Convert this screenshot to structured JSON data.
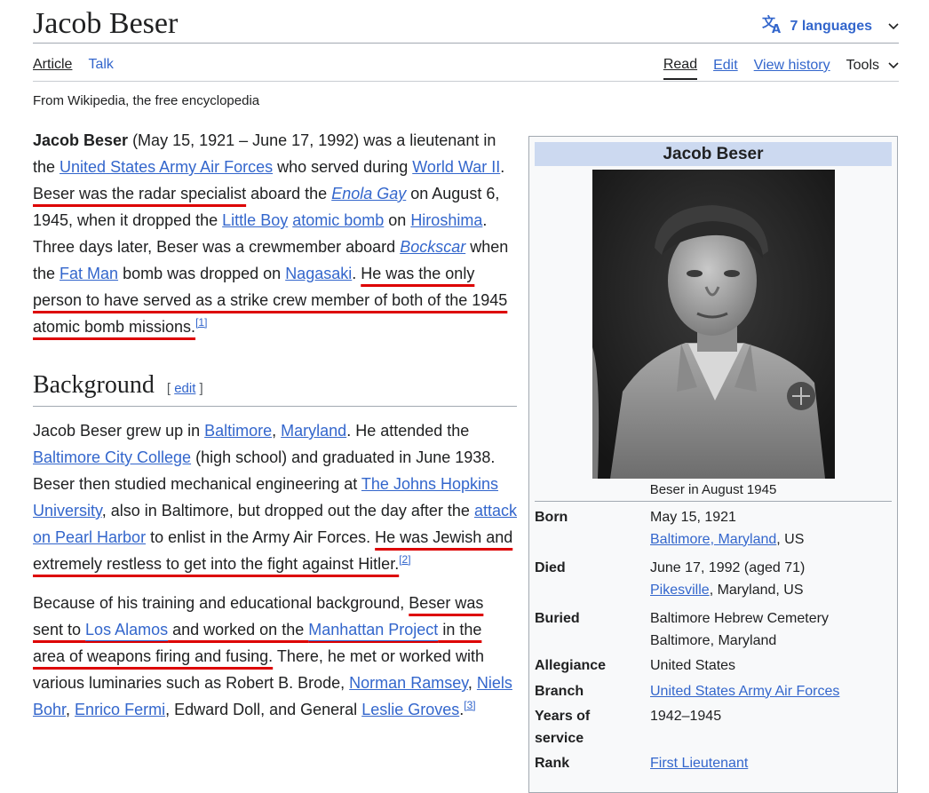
{
  "article": {
    "title": "Jacob Beser",
    "languages_label": "7 languages",
    "tagline": "From Wikipedia, the free encyclopedia"
  },
  "tabs": {
    "article": "Article",
    "talk": "Talk",
    "read": "Read",
    "edit": "Edit",
    "history": "View history",
    "tools": "Tools"
  },
  "intro": {
    "s1_bold": "Jacob Beser",
    "s1_a": " (May 15, 1921 – June 17, 1992) was a lieutenant in the ",
    "s1_link1": "United States Army Air Forces",
    "s1_b": " who served during ",
    "s1_link2": "World War II",
    "s1_c": ". ",
    "s2_hl": "Beser was the radar specialist",
    "s2_a": " aboard the ",
    "s2_link1": "Enola Gay",
    "s2_b": " on August 6, 1945, when it dropped the ",
    "s2_link2": "Little Boy",
    "s2_c": " ",
    "s2_link3": "atomic bomb",
    "s2_d": " on ",
    "s2_link4": "Hiroshima",
    "s2_e": ". Three days later, Beser was a crewmember aboard ",
    "s3_link1": "Bockscar",
    "s3_a": " when the ",
    "s3_link2": "Fat Man",
    "s3_b": " bomb was dropped on ",
    "s3_link3": "Nagasaki",
    "s3_c": ". ",
    "s4_hl": "He was the only person to have served as a strike crew member of both of the 1945 atomic bomb missions.",
    "ref": "[1]"
  },
  "background": {
    "heading": "Background",
    "edit_open": "[ ",
    "edit_label": "edit",
    "edit_close": " ]",
    "p1_a": "Jacob Beser grew up in ",
    "p1_link1": "Baltimore",
    "p1_b": ", ",
    "p1_link2": "Maryland",
    "p1_c": ". He attended the ",
    "p1_link3": "Baltimore City College",
    "p1_d": " (high school) and graduated in June 1938. Beser then studied mechanical engineering at ",
    "p1_link4": "The Johns Hopkins University",
    "p1_e": ", also in Baltimore, but dropped out the day after the ",
    "p1_link5": "attack on Pearl Harbor",
    "p1_f": " to enlist in the Army Air Forces. ",
    "p1_hl": "He was Jewish and extremely restless to get into the fight against Hitler.",
    "p1_ref": "[2]",
    "p2_a": "Because of his training and educational background, ",
    "p2_hl_a": "Beser was sent to ",
    "p2_hl_link1": "Los Alamos",
    "p2_hl_b": " and worked on the ",
    "p2_hl_link2": "Manhattan Project",
    "p2_hl_c": " in the area of weapons firing and fusing.",
    "p2_b": " There, he met or worked with various luminaries such as Robert B. Brode, ",
    "p2_link3": "Norman Ramsey",
    "p2_c": ", ",
    "p2_link4": "Niels Bohr",
    "p2_d": ", ",
    "p2_link5": "Enrico Fermi",
    "p2_e": ", Edward Doll, and General ",
    "p2_link6": "Leslie Groves",
    "p2_f": ".",
    "p2_ref": "[3]"
  },
  "infobox": {
    "title": "Jacob Beser",
    "caption": "Beser in August 1945",
    "born_label": "Born",
    "born_date": "May 15, 1921",
    "born_place_link": "Baltimore, Maryland",
    "born_place_rest": ", US",
    "died_label": "Died",
    "died_date": "June 17, 1992 (aged 71)",
    "died_place_link": "Pikesville",
    "died_place_rest": ", Maryland, US",
    "buried_label": "Buried",
    "buried_value1": "Baltimore Hebrew Cemetery",
    "buried_value2": "Baltimore, Maryland",
    "allegiance_label": "Allegiance",
    "allegiance_value": "United States",
    "branch_label": "Branch",
    "branch_value": "United States Army Air Forces",
    "years_label": "Years of service",
    "years_value": "1942–1945",
    "rank_label": "Rank",
    "rank_value": "First Lieutenant"
  },
  "colors": {
    "link": "#3366cc",
    "highlight_underline": "#dd0000",
    "infobox_header": "#ccd9f0"
  }
}
